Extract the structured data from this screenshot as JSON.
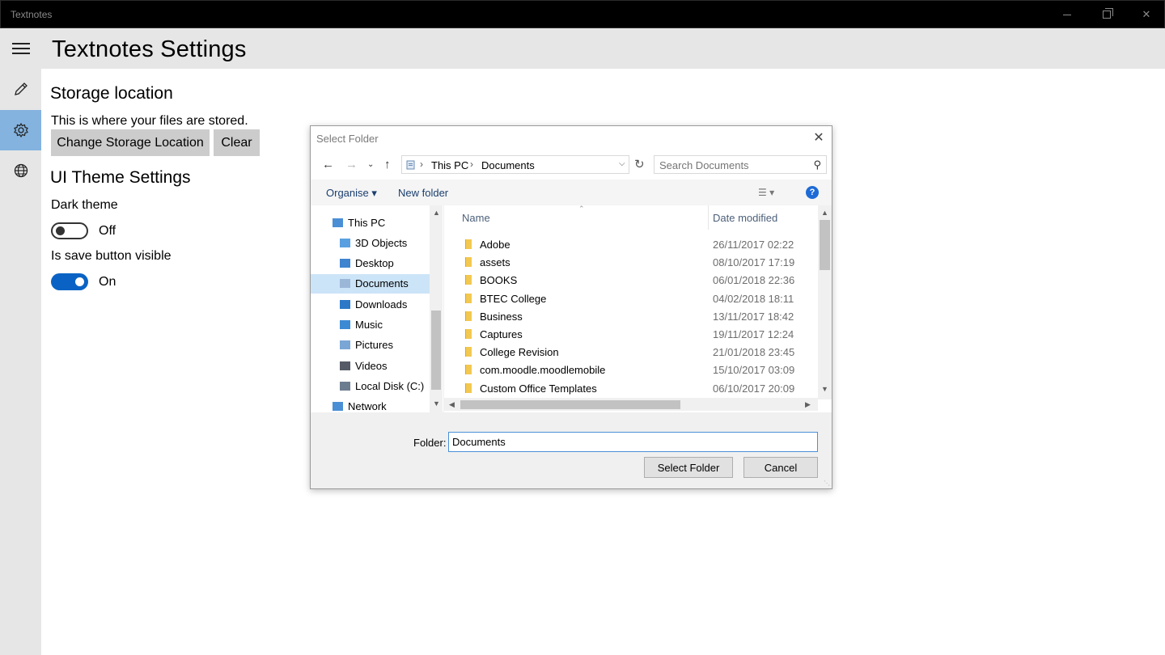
{
  "window": {
    "title": "Textnotes",
    "minimize_glyph": "",
    "close_glyph": "✕"
  },
  "rail": {
    "items": [
      {
        "name": "hamburger-menu",
        "icon": "hamburger-icon"
      },
      {
        "name": "notes",
        "icon": "pencil-icon"
      },
      {
        "name": "settings",
        "icon": "gear-icon"
      },
      {
        "name": "language",
        "icon": "globe-icon"
      }
    ],
    "active_color": "#84b3df"
  },
  "header": {
    "title": "Textnotes Settings"
  },
  "storage": {
    "title": "Storage location",
    "description": "This is where your files are stored.",
    "change_button": "Change Storage Location",
    "clear_button": "Clear"
  },
  "theme": {
    "title": "UI Theme Settings",
    "dark_theme_label": "Dark theme",
    "dark_theme_state": "Off",
    "save_button_label": "Is save button visible",
    "save_button_state": "On",
    "accent_color": "#0a63c4"
  },
  "dialog": {
    "title": "Select Folder",
    "close_glyph": "✕",
    "address": {
      "crumbs": [
        "This PC",
        "Documents"
      ]
    },
    "search_placeholder": "Search Documents",
    "commands": {
      "organise": "Organise ▾",
      "new_folder": "New folder",
      "help": "?"
    },
    "tree": [
      {
        "label": "This PC",
        "indent": 0,
        "icon": "pc-icon",
        "selected": false
      },
      {
        "label": "3D Objects",
        "indent": 1,
        "icon": "3d-objects-icon",
        "selected": false
      },
      {
        "label": "Desktop",
        "indent": 1,
        "icon": "desktop-icon",
        "selected": false
      },
      {
        "label": "Documents",
        "indent": 1,
        "icon": "documents-icon",
        "selected": true
      },
      {
        "label": "Downloads",
        "indent": 1,
        "icon": "downloads-icon",
        "selected": false
      },
      {
        "label": "Music",
        "indent": 1,
        "icon": "music-icon",
        "selected": false
      },
      {
        "label": "Pictures",
        "indent": 1,
        "icon": "pictures-icon",
        "selected": false
      },
      {
        "label": "Videos",
        "indent": 1,
        "icon": "videos-icon",
        "selected": false
      },
      {
        "label": "Local Disk (C:)",
        "indent": 1,
        "icon": "disk-icon",
        "selected": false
      },
      {
        "label": "Network",
        "indent": 0,
        "icon": "network-icon",
        "selected": false
      }
    ],
    "columns": {
      "name": "Name",
      "date": "Date modified"
    },
    "rows": [
      {
        "name": "Adobe",
        "date": "26/11/2017 02:22"
      },
      {
        "name": "assets",
        "date": "08/10/2017 17:19"
      },
      {
        "name": "BOOKS",
        "date": "06/01/2018 22:36"
      },
      {
        "name": "BTEC College",
        "date": "04/02/2018 18:11"
      },
      {
        "name": "Business",
        "date": "13/11/2017 18:42"
      },
      {
        "name": "Captures",
        "date": "19/11/2017 12:24"
      },
      {
        "name": "College Revision",
        "date": "21/01/2018 23:45"
      },
      {
        "name": "com.moodle.moodlemobile",
        "date": "15/10/2017 03:09"
      },
      {
        "name": "Custom Office Templates",
        "date": "06/10/2017 20:09"
      }
    ],
    "folder_label": "Folder:",
    "folder_value": "Documents",
    "select_button": "Select Folder",
    "cancel_button": "Cancel",
    "selection_color": "#cce4f7",
    "folder_color": "#f3c850"
  }
}
